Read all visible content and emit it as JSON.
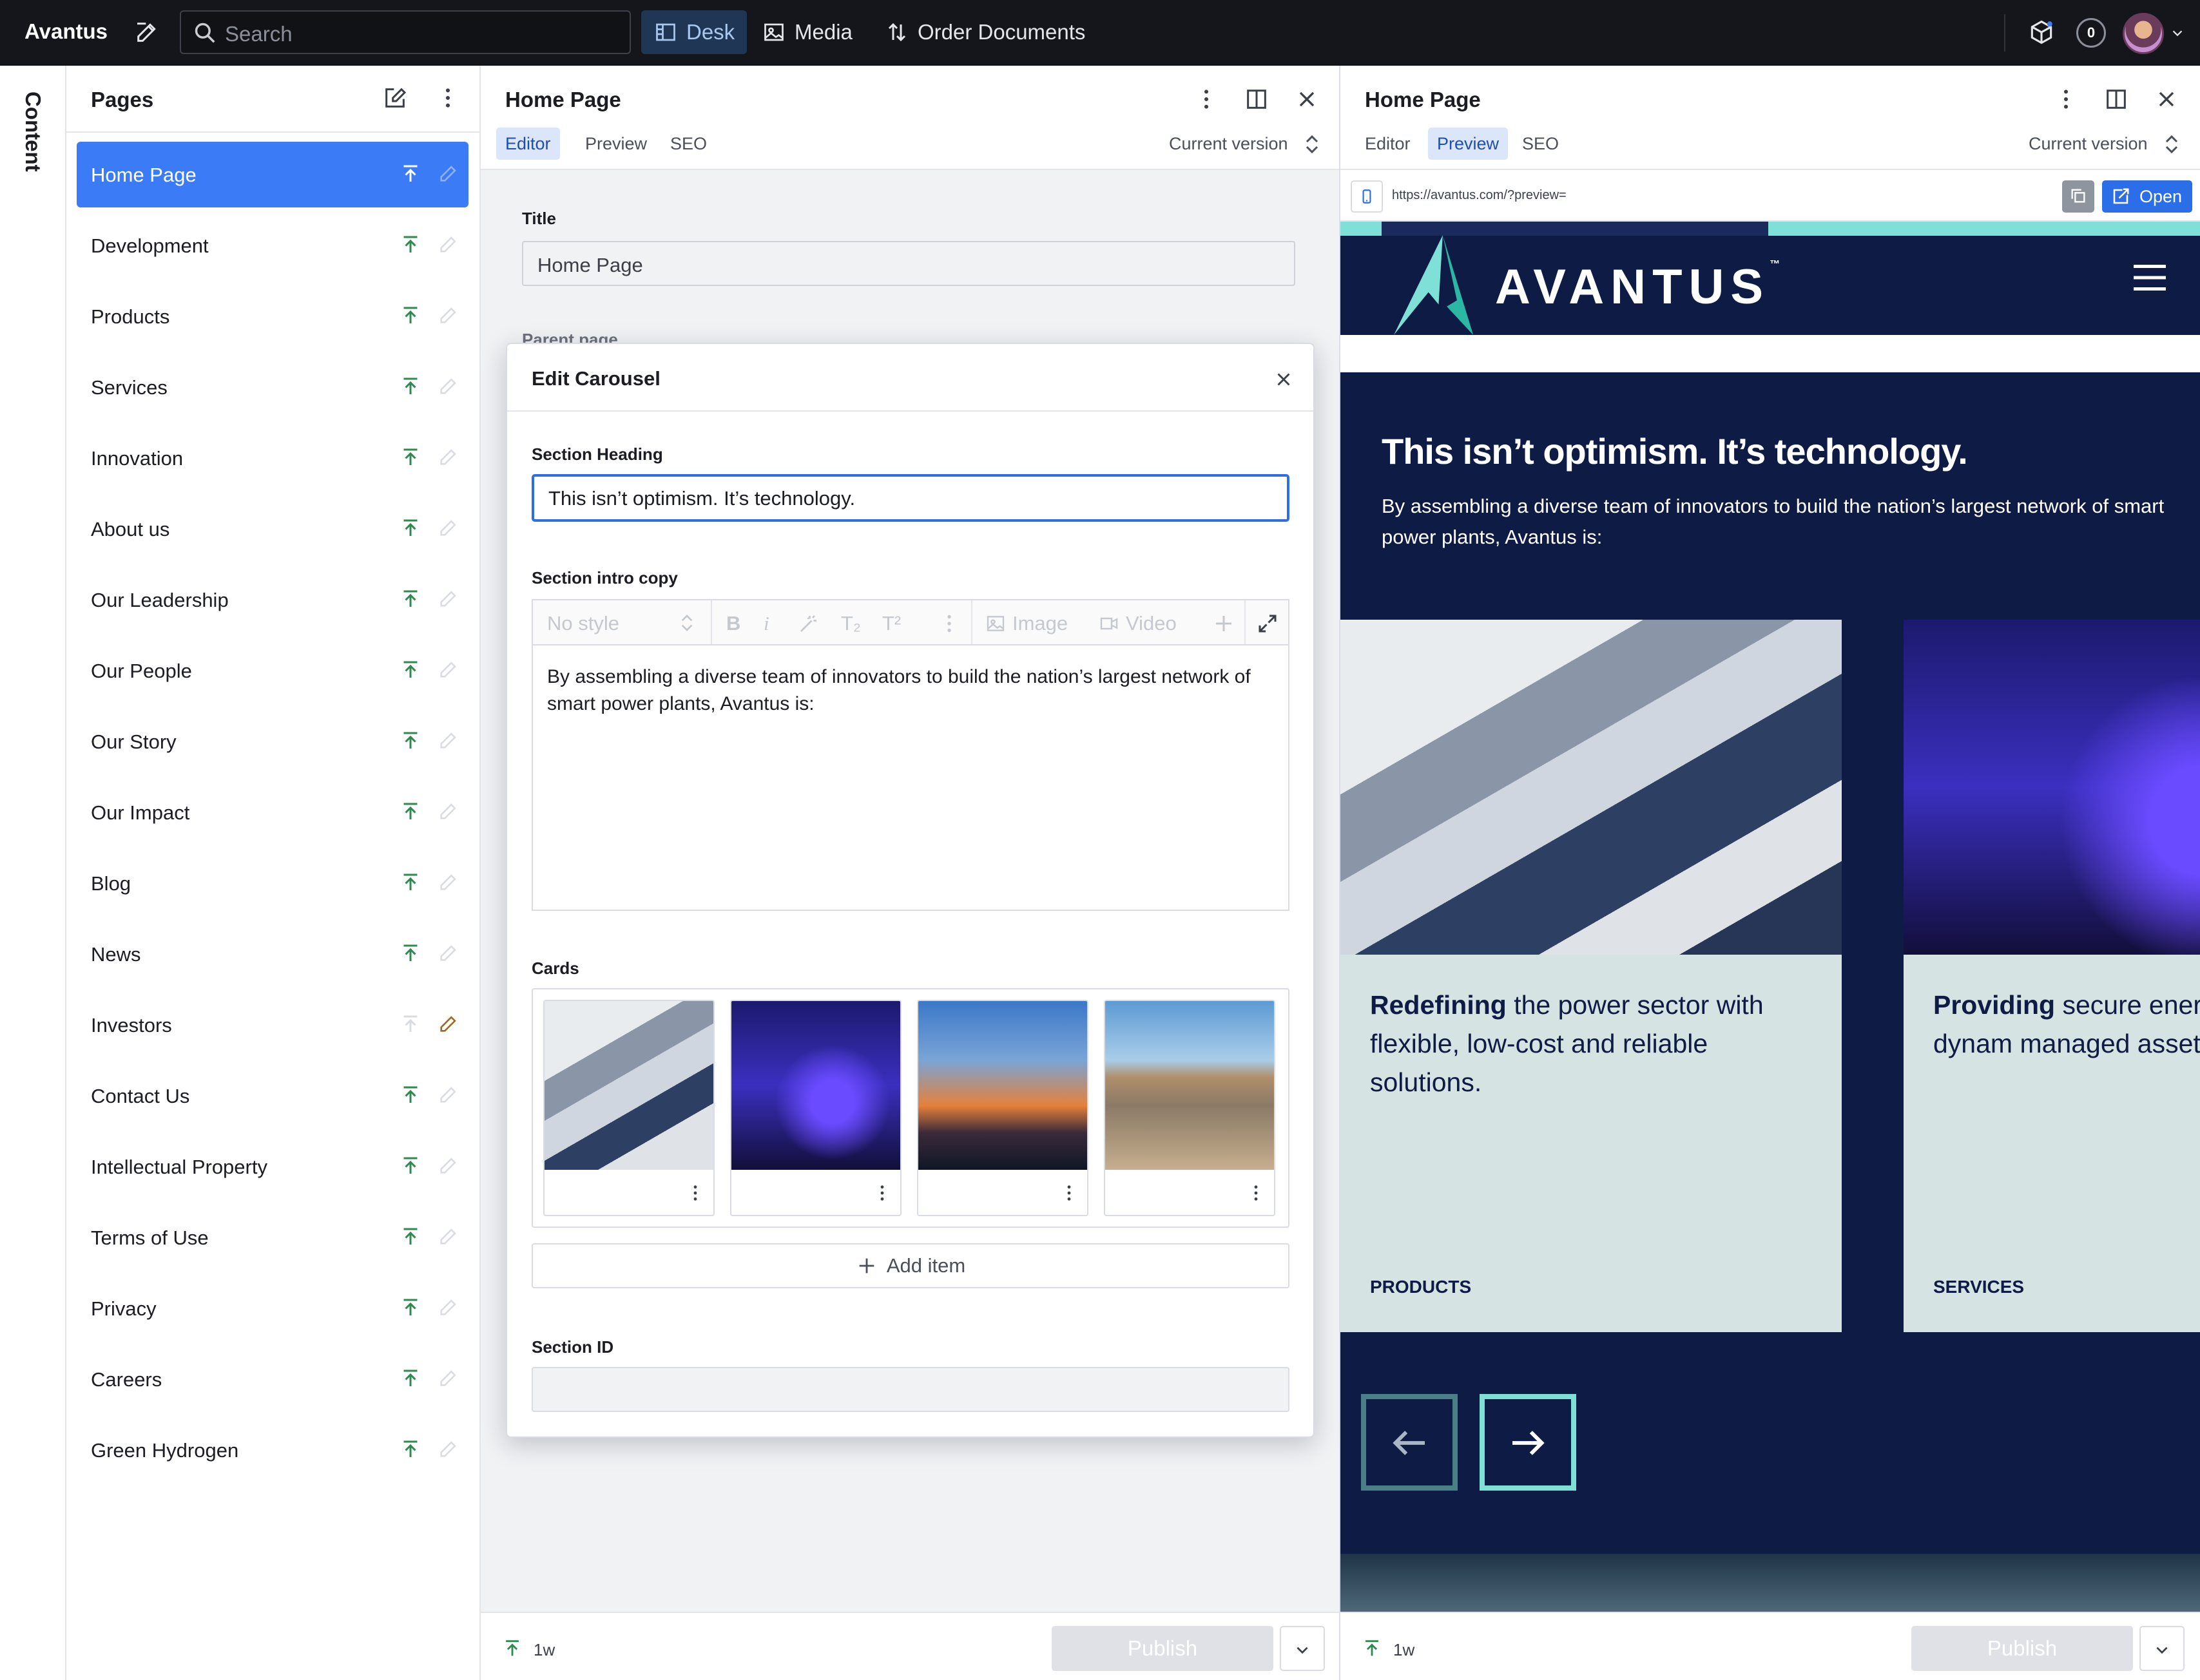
{
  "topbar": {
    "brand": "Avantus",
    "search_placeholder": "Search",
    "tabs": [
      {
        "label": "Desk",
        "icon": "desk-icon",
        "active": true
      },
      {
        "label": "Media",
        "icon": "image-icon"
      },
      {
        "label": "Order Documents",
        "icon": "sort-icon"
      }
    ],
    "notification_count": "0"
  },
  "rail": {
    "label": "Content"
  },
  "pages": {
    "title": "Pages",
    "items": [
      {
        "label": "Home Page",
        "selected": true
      },
      {
        "label": "Development"
      },
      {
        "label": "Products"
      },
      {
        "label": "Services"
      },
      {
        "label": "Innovation"
      },
      {
        "label": "About us"
      },
      {
        "label": "Our Leadership"
      },
      {
        "label": "Our People"
      },
      {
        "label": "Our Story"
      },
      {
        "label": "Our Impact"
      },
      {
        "label": "Blog"
      },
      {
        "label": "News"
      },
      {
        "label": "Investors",
        "draft": true
      },
      {
        "label": "Contact Us"
      },
      {
        "label": "Intellectual Property"
      },
      {
        "label": "Terms of Use"
      },
      {
        "label": "Privacy"
      },
      {
        "label": "Careers"
      },
      {
        "label": "Green Hydrogen"
      }
    ]
  },
  "editor": {
    "title": "Home Page",
    "tabs": [
      "Editor",
      "Preview",
      "SEO"
    ],
    "active_tab": "Editor",
    "version": "Current version",
    "title_label": "Title",
    "title_value": "Home Page",
    "parent_label": "Parent page",
    "footer_since": "1w",
    "publish": "Publish"
  },
  "dialog": {
    "title": "Edit Carousel",
    "heading_label": "Section Heading",
    "heading_value": "This isn’t optimism. It’s technology.",
    "intro_label": "Section intro copy",
    "toolbar": {
      "style": "No style",
      "bold": "B",
      "italic": "i",
      "sub": "T₂",
      "sup": "T²",
      "image": "Image",
      "video": "Video"
    },
    "intro_value": "By assembling a diverse team of innovators to build the nation’s largest network of smart power plants, Avantus is:",
    "cards_label": "Cards",
    "add_item": "Add item",
    "section_id_label": "Section ID",
    "section_id_value": ""
  },
  "preview": {
    "title": "Home Page",
    "tabs": [
      "Editor",
      "Preview",
      "SEO"
    ],
    "active_tab": "Preview",
    "version": "Current version",
    "url": "https://avantus.com/?preview=",
    "open": "Open",
    "footer_since": "1w",
    "publish": "Publish",
    "site": {
      "logo": "AVANTUS",
      "logo_tm": "™",
      "heading": "This isn’t optimism. It’s technology.",
      "intro": "By assembling a diverse team of innovators to build the nation’s largest network of smart power plants, Avantus is:",
      "cards": [
        {
          "bold": "Redefining",
          "text": " the power sector with flexible, low-cost and reliable solutions.",
          "category": "PRODUCTS"
        },
        {
          "bold": "Providing",
          "text": " secure ener networked and dynam managed assets.",
          "category": "SERVICES"
        }
      ]
    }
  },
  "colors": {
    "accent": "#3b7cf6",
    "publish_green": "#2e8a4e",
    "site_navy": "#0e1b45",
    "site_teal": "#7ee0d6",
    "card_bg": "#d6e3e3"
  }
}
